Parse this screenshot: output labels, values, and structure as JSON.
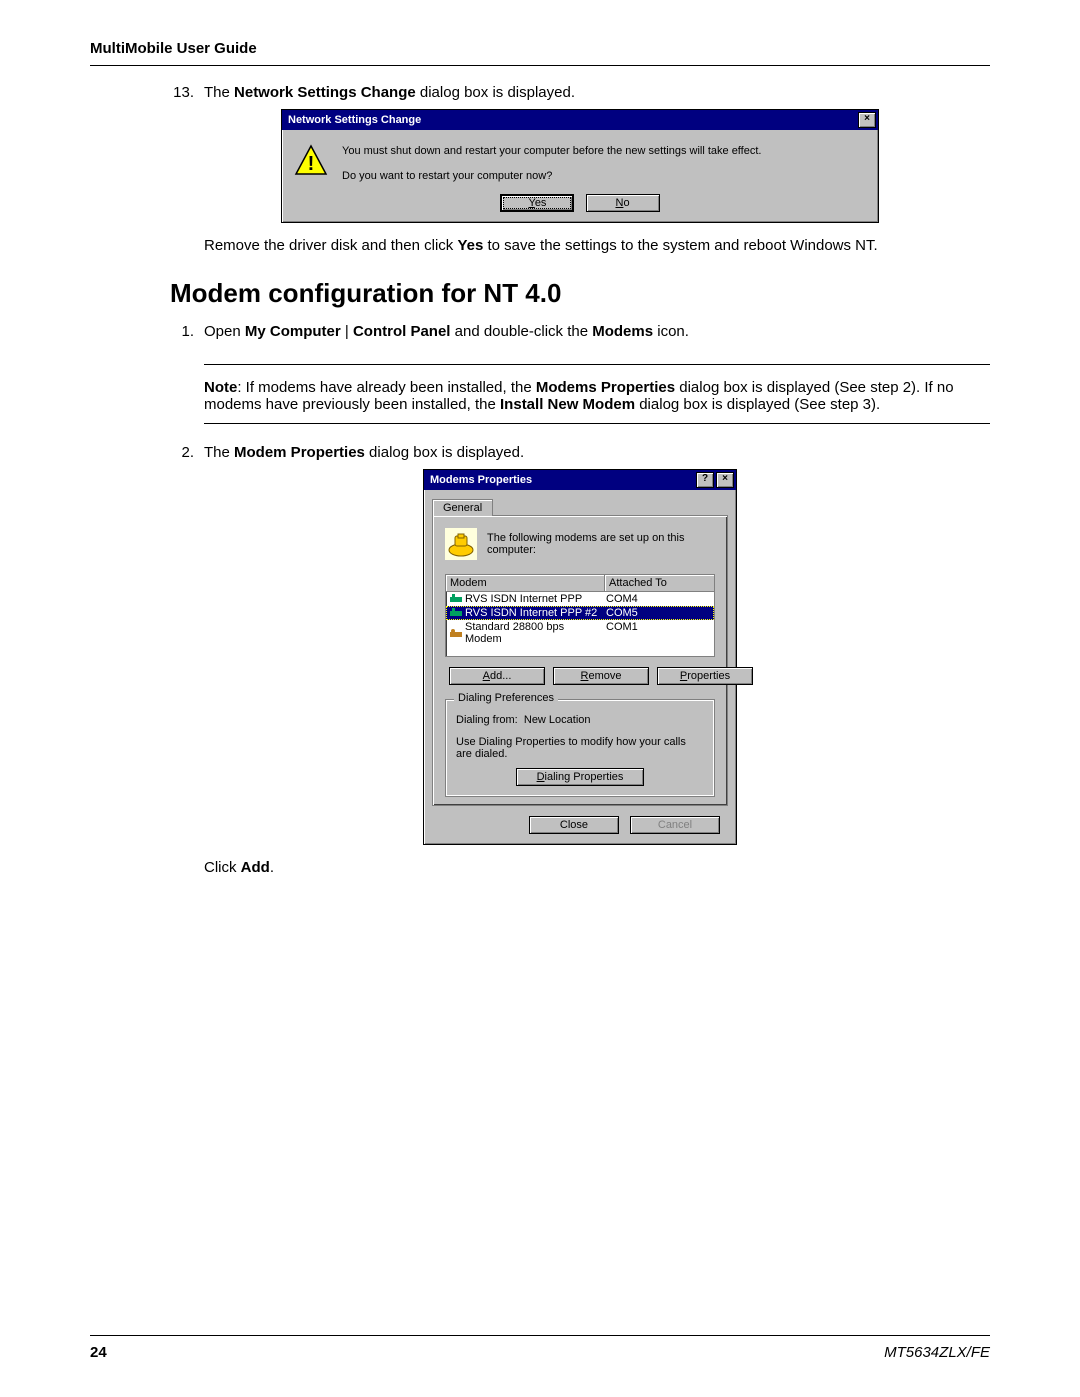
{
  "header": {
    "title": "MultiMobile User Guide"
  },
  "footer": {
    "page": "24",
    "model": "MT5634ZLX/FE"
  },
  "step13": {
    "num": "13.",
    "text_before": "The ",
    "bold": "Network Settings Change",
    "text_after": " dialog box is displayed."
  },
  "dlg1": {
    "title": "Network Settings Change",
    "line1": "You must shut down and restart your computer before the new settings will take effect.",
    "line2": "Do you want to restart your computer now?",
    "yes_u": "Y",
    "yes_rest": "es",
    "no_u": "N",
    "no_rest": "o"
  },
  "after_dlg1": {
    "t1": "Remove the driver disk and then click ",
    "b1": "Yes",
    "t2": " to save the settings to the system and reboot Windows NT."
  },
  "section_title": "Modem configuration for NT 4.0",
  "step1": {
    "num": "1.",
    "t1": "Open ",
    "b1": "My Computer",
    "t2": " | ",
    "b2": "Control Panel",
    "t3": " and double-click the ",
    "b3": "Modems",
    "t4": " icon."
  },
  "note": {
    "label": "Note",
    "t1": ": If modems have already been installed, the ",
    "b1": "Modems Properties",
    "t2": " dialog box is displayed (See step 2). If no modems have previously been installed, the ",
    "b2": "Install New Modem",
    "t3": " dialog box is displayed (See step 3)."
  },
  "step2": {
    "num": "2.",
    "t1": "The ",
    "b1": "Modem Properties",
    "t2": " dialog box is displayed."
  },
  "dlg2": {
    "title": "Modems Properties",
    "tab": "General",
    "intro": "The following modems are set up on this computer:",
    "col1": "Modem",
    "col2": "Attached To",
    "rows": [
      {
        "name": "RVS ISDN Internet PPP",
        "port": "COM4"
      },
      {
        "name": "RVS ISDN Internet PPP #2",
        "port": "COM5"
      },
      {
        "name": "Standard 28800 bps Modem",
        "port": "COM1"
      }
    ],
    "add_u": "A",
    "add_rest": "dd...",
    "remove_u": "R",
    "remove_rest": "emove",
    "props_u": "P",
    "props_rest": "roperties",
    "group_title": "Dialing Preferences",
    "dial_from_lbl": "Dialing from:",
    "dial_from_val": "New Location",
    "dial_desc": "Use Dialing Properties to modify how your calls are dialed.",
    "dialprops_u": "D",
    "dialprops_rest": "ialing Properties",
    "close": "Close",
    "cancel": "Cancel"
  },
  "after_dlg2": {
    "t1": "Click ",
    "b1": "Add",
    "t2": "."
  }
}
